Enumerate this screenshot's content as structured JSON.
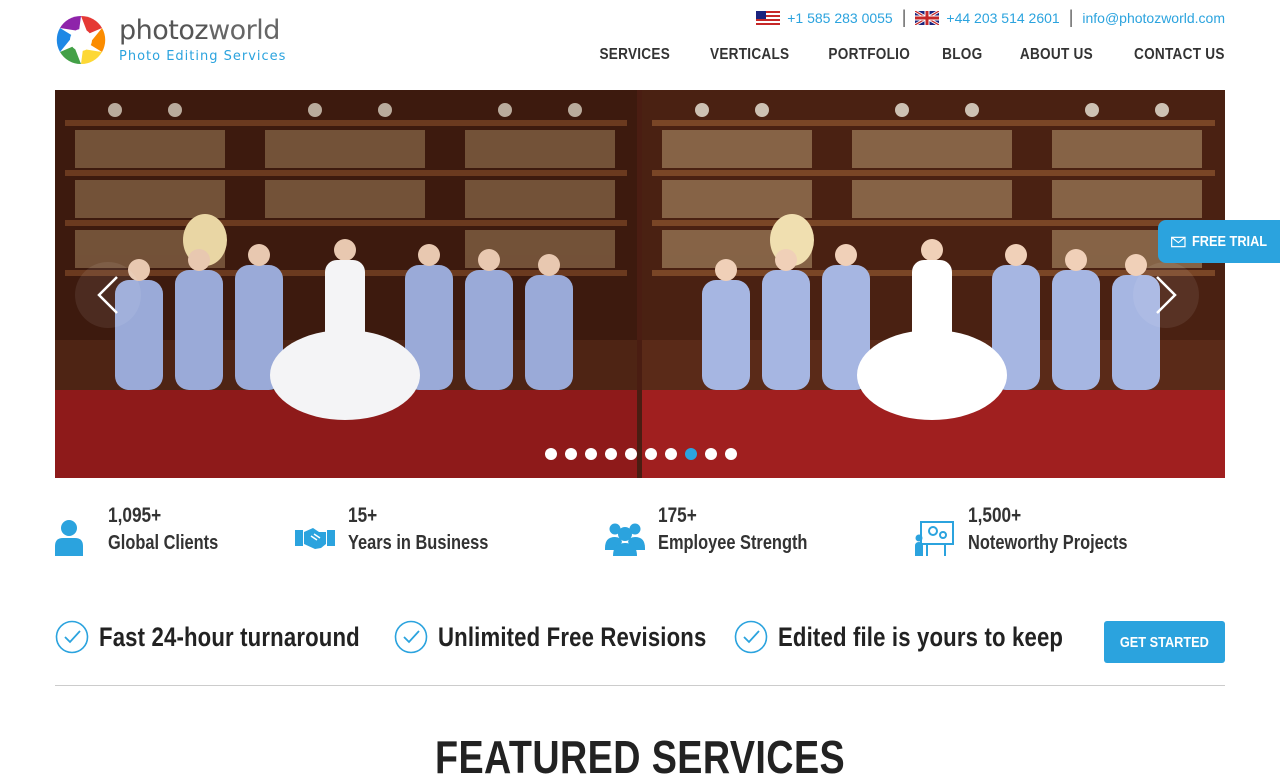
{
  "brand": {
    "name_part1": "photoz",
    "name_part2": "world",
    "tagline": "Photo Editing Services"
  },
  "contact": {
    "us_phone": "+1 585 283 0055",
    "uk_phone": "+44 203 514 2601",
    "email": "info@photozworld.com",
    "separator": "|"
  },
  "nav": {
    "items": [
      {
        "label": "SERVICES"
      },
      {
        "label": "VERTICALS"
      },
      {
        "label": "PORTFOLIO"
      },
      {
        "label": "BLOG"
      },
      {
        "label": "ABOUT US"
      },
      {
        "label": "CONTACT US"
      }
    ]
  },
  "slider": {
    "slide_count": 10,
    "active_index": 7
  },
  "free_trial": {
    "label": "FREE TRIAL"
  },
  "stats": [
    {
      "value": "1,095+",
      "label": "Global Clients",
      "icon": "user-icon"
    },
    {
      "value": "15+",
      "label": "Years in Business",
      "icon": "handshake-icon"
    },
    {
      "value": "175+",
      "label": "Employee Strength",
      "icon": "team-icon"
    },
    {
      "value": "1,500+",
      "label": "Noteworthy Projects",
      "icon": "presentation-icon"
    }
  ],
  "features": [
    {
      "text": "Fast 24-hour turnaround"
    },
    {
      "text": "Unlimited Free Revisions"
    },
    {
      "text": "Edited file is yours to keep"
    }
  ],
  "cta": {
    "get_started": "GET STARTED"
  },
  "section": {
    "featured_title": "FEATURED SERVICES"
  },
  "colors": {
    "accent": "#2ba3de",
    "text": "#333333",
    "dot_inactive": "#ffffff"
  }
}
